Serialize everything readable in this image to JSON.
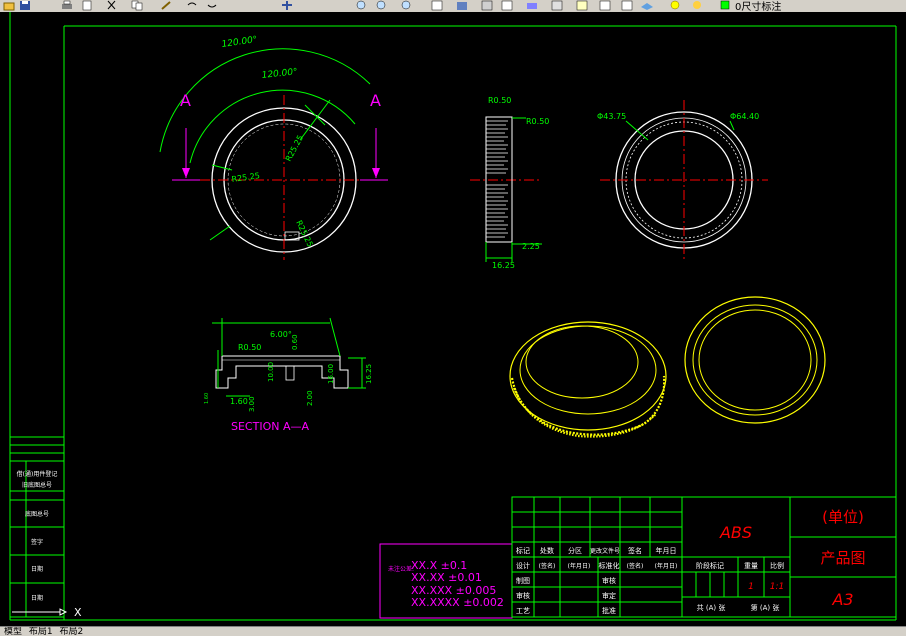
{
  "toolbar": {
    "icons": [
      "open-icon",
      "save-icon",
      "print-icon",
      "preview-icon",
      "cut-icon",
      "copy-icon",
      "paste-icon",
      "match-icon",
      "undo-icon",
      "redo-icon",
      "pan-icon",
      "zoom-realtime-icon",
      "zoom-window-icon",
      "zoom-previous-icon",
      "properties-icon",
      "design-center-icon",
      "tool-palette-icon",
      "sheet-set-icon",
      "markup-icon",
      "calc-icon",
      "help-icon",
      "layers-icon",
      "layer-state-icon"
    ],
    "layer_label": "0尺寸标注"
  },
  "drawing": {
    "section_label": "SECTION  A—A",
    "cut_label_left": "A",
    "cut_label_right": "A",
    "dims": {
      "angle_outer": "120.00°",
      "angle_inner": "120.00°",
      "r_inner": "R25.25",
      "r_2": "R25.25",
      "r_3": "R25.25",
      "side_r1": "R0.50",
      "side_r2": "R0.50",
      "side_w": "16.25",
      "side_h": "2.25",
      "dia_inner": "Φ43.75",
      "dia_outer": "Φ64.40",
      "sec_top": "6.00°",
      "sec_r": "R0.50",
      "sec_h1": "0.60",
      "sec_h2": "10.00",
      "sec_h3": "16.00",
      "sec_h4": "16.25",
      "sec_w1": "1.60",
      "sec_w2": "3.00",
      "sec_w3": "2.00",
      "sec_w4": "1.60"
    },
    "tolerance": {
      "label": "未注公差:",
      "lines": [
        "XX.X  ±0.1",
        "XX.XX  ±0.01",
        "XX.XXX  ±0.005",
        "XX.XXXX  ±0.002"
      ]
    },
    "left_strip": [
      "借(通)用件登记",
      "旧底图总号",
      "底图总号",
      "签字",
      "日期",
      "日期"
    ],
    "title_block": {
      "material": "ABS",
      "company": "(单位)",
      "drawing_name": "产品图",
      "size": "A3",
      "header_row": [
        "标记",
        "处数",
        "分区",
        "更改文件号",
        "签名",
        "年月日"
      ],
      "row2": [
        "设计",
        "(签名)",
        "(年月日)",
        "标准化",
        "(签名)",
        "(年月日)"
      ],
      "row3": [
        "制图",
        "",
        "",
        "审核",
        "",
        ""
      ],
      "row4": [
        "审核",
        "",
        "",
        "审定",
        "",
        ""
      ],
      "row5": [
        "工艺",
        "",
        "",
        "批准",
        "",
        ""
      ],
      "stage_header": [
        "阶段标记",
        "重量",
        "比例"
      ],
      "qty": "1",
      "scale": "1:1",
      "sheet_row": [
        "共 (A) 张",
        "第 (A) 张"
      ]
    }
  },
  "status": {
    "tabs": [
      "模型",
      "布局1",
      "布局2"
    ]
  },
  "colors": {
    "green": "#00ff00",
    "white": "#ffffff",
    "red": "#ff0000",
    "magenta": "#ff00ff",
    "yellow": "#ffff00",
    "cyan": "#00ffff"
  }
}
